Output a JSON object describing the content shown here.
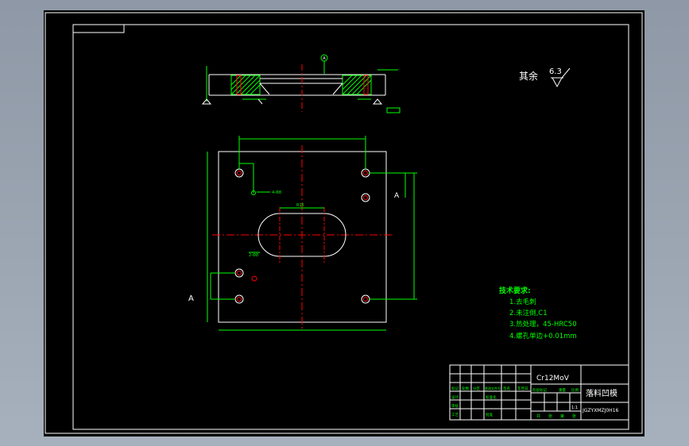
{
  "surface_roughness": {
    "label": "其余",
    "value": "6.3"
  },
  "section_view": {
    "datum_mark": "A"
  },
  "plan_view": {
    "view_label": "A",
    "hole_annotations": [
      "4-Φ8",
      "2-Φ8"
    ],
    "slot_dim": "R15"
  },
  "technical_requirements": {
    "title": "技术要求:",
    "items": [
      "1.去毛刺",
      "2.未注倒,C1",
      "3.热处理，45-HRC50",
      "4.螺孔单边+0.01mm"
    ]
  },
  "title_block": {
    "material": "Cr12MoV",
    "part_name": "落料凹模",
    "drawing_no": "JGZYXMZJ0H16",
    "scale": "1:1",
    "sheet_labels": [
      "共",
      "张",
      "第",
      "张"
    ],
    "left_labels": [
      "标记",
      "处数",
      "分区",
      "更改文件号",
      "签名",
      "年月日",
      "设计",
      "标准化",
      "审核",
      "工艺",
      "批准"
    ],
    "stage_labels": [
      "阶段标记",
      "重量",
      "比例"
    ]
  },
  "colors": {
    "background": "#000000",
    "lines": "#ffffff",
    "centerline": "#ff0000",
    "dimension": "#00ff00",
    "text": "#ffffff"
  }
}
